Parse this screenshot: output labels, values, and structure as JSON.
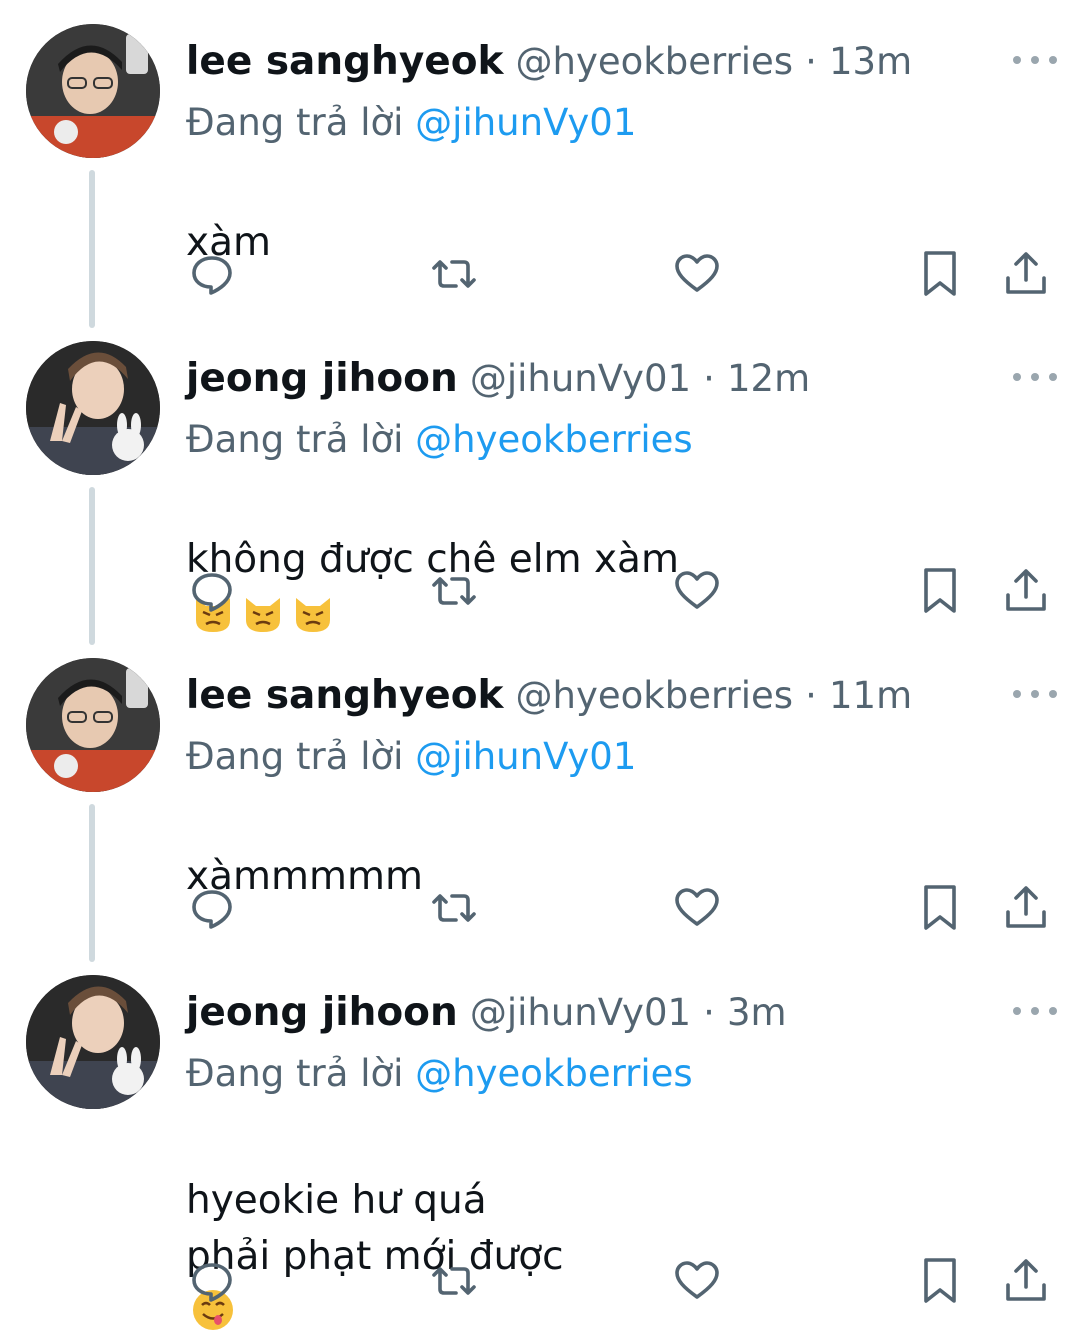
{
  "reply_prefix": "Đang trả lời",
  "colors": {
    "text": "#0f1419",
    "secondary": "#536471",
    "link": "#1d9bf0",
    "thread_line": "#cfd9de"
  },
  "tweets": [
    {
      "name": "lee sanghyeok",
      "handle": "@hyeokberries",
      "dot": "·",
      "time": "13m",
      "reply_to": "@jihunVy01",
      "text": "xàm",
      "avatar": "user-avatar-photo",
      "emoji": []
    },
    {
      "name": "jeong jihoon",
      "handle": "@jihunVy01",
      "dot": "·",
      "time": "12m",
      "reply_to": "@hyeokberries",
      "text": "không được chê elm xàm",
      "avatar": "user-avatar-photo",
      "emoji": [
        "pouting-cat-emoji",
        "pouting-cat-emoji",
        "pouting-cat-emoji"
      ]
    },
    {
      "name": "lee sanghyeok",
      "handle": "@hyeokberries",
      "dot": "·",
      "time": "11m",
      "reply_to": "@jihunVy01",
      "text": "xàmmmmm",
      "avatar": "user-avatar-photo",
      "emoji": []
    },
    {
      "name": "jeong jihoon",
      "handle": "@jihunVy01",
      "dot": "·",
      "time": "3m",
      "reply_to": "@hyeokberries",
      "text": "hyeokie hư quá\nphải phạt mới được",
      "avatar": "user-avatar-photo",
      "emoji": [
        "yum-face-emoji"
      ]
    }
  ],
  "action_icons": [
    "reply-icon",
    "retweet-icon",
    "like-icon",
    "bookmark-icon",
    "share-icon"
  ]
}
